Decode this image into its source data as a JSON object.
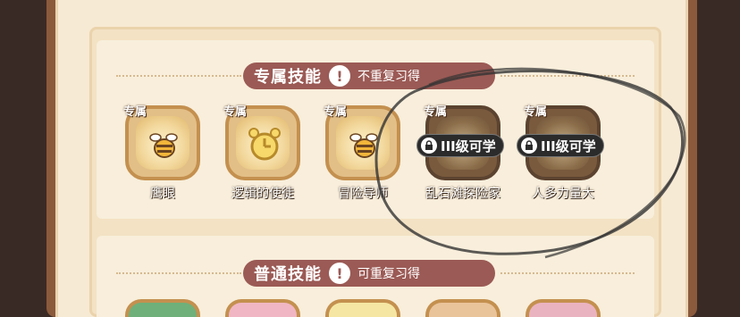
{
  "exclusive_section": {
    "title": "专属技能",
    "note": "不重复习得",
    "warn_icon": "!"
  },
  "common_section": {
    "title": "普通技能",
    "note": "可重复习得",
    "warn_icon": "!"
  },
  "skills": [
    {
      "tag": "专属",
      "name": "鹰眼",
      "icon": "bee-icon",
      "locked": false
    },
    {
      "tag": "专属",
      "name": "逻辑的使徒",
      "icon": "alarm-clock-icon",
      "locked": false
    },
    {
      "tag": "专属",
      "name": "冒险导师",
      "icon": "bee-icon",
      "locked": false
    },
    {
      "tag": "专属",
      "name": "乱石滩探险家",
      "icon": "rocks-icon",
      "locked": true,
      "lock_text": "III级可学"
    },
    {
      "tag": "专属",
      "name": "人多力量大",
      "icon": "crowd-icon",
      "locked": true,
      "lock_text": "III级可学"
    }
  ],
  "colors": {
    "header_bg": "#9b5a55",
    "panel_bg": "#f7ead4",
    "frame": "#8b5a3c"
  }
}
